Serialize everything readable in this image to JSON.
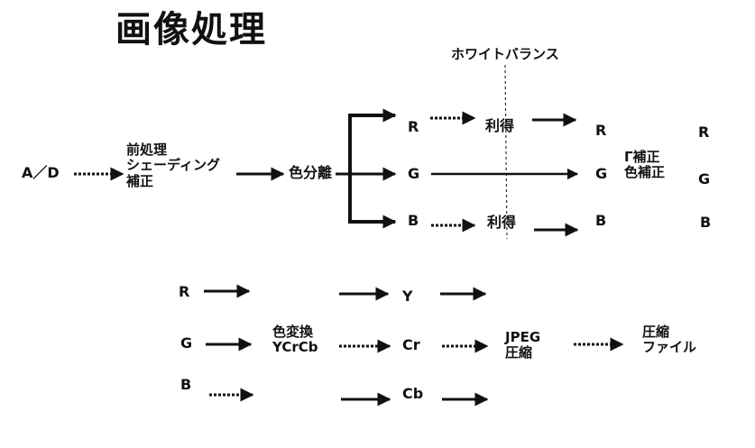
{
  "title": "画像処理",
  "white_balance_label": "ホワイトバランス",
  "stage1": {
    "ad": "A／D",
    "preprocess": "前処理\nシェーディング\n補正",
    "color_sep": "色分離",
    "r_in": "R",
    "g_in": "G",
    "b_in": "B",
    "gain_r": "利得",
    "gain_b": "利得",
    "r_out": "R",
    "g_out": "G",
    "b_out": "B",
    "correction": "Γ補正\n色補正",
    "r_final": "R",
    "g_final": "G",
    "b_final": "B"
  },
  "stage2": {
    "r": "R",
    "g": "G",
    "b": "B",
    "color_convert": "色変換\nYCrCb",
    "y": "Y",
    "cr": "Cr",
    "cb": "Cb",
    "jpeg": "JPEG\n圧縮",
    "output": "圧縮\nファイル"
  }
}
